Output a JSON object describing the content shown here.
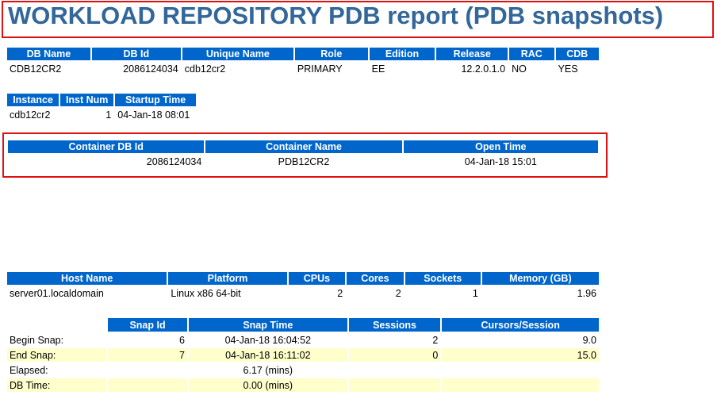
{
  "title": "WORKLOAD REPOSITORY PDB report (PDB snapshots)",
  "db_table": {
    "headers": [
      "DB Name",
      "DB Id",
      "Unique Name",
      "Role",
      "Edition",
      "Release",
      "RAC",
      "CDB"
    ],
    "row": [
      "CDB12CR2",
      "2086124034",
      "cdb12cr2",
      "PRIMARY",
      "EE",
      "12.2.0.1.0",
      "NO",
      "YES"
    ]
  },
  "instance_table": {
    "headers": [
      "Instance",
      "Inst Num",
      "Startup Time"
    ],
    "row": [
      "cdb12cr2",
      "1",
      "04-Jan-18 08:01"
    ]
  },
  "container_table": {
    "headers": [
      "Container DB Id",
      "Container Name",
      "Open Time"
    ],
    "row": [
      "2086124034",
      "PDB12CR2",
      "04-Jan-18 15:01"
    ]
  },
  "host_table": {
    "headers": [
      "Host Name",
      "Platform",
      "CPUs",
      "Cores",
      "Sockets",
      "Memory (GB)"
    ],
    "row": [
      "server01.localdomain",
      "Linux x86 64-bit",
      "2",
      "2",
      "1",
      "1.96"
    ]
  },
  "snap_table": {
    "headers": [
      "",
      "Snap Id",
      "Snap Time",
      "Sessions",
      "Cursors/Session"
    ],
    "rows": [
      [
        "Begin Snap:",
        "6",
        "04-Jan-18 16:04:52",
        "2",
        "9.0"
      ],
      [
        "End Snap:",
        "7",
        "04-Jan-18 16:11:02",
        "0",
        "15.0"
      ],
      [
        "Elapsed:",
        "",
        "6.17 (mins)",
        "",
        ""
      ],
      [
        "DB Time:",
        "",
        "0.00 (mins)",
        "",
        ""
      ]
    ]
  },
  "highlight_color": "#dd1111",
  "header_color": "#0066cc",
  "alt_row_color": "#ffffcc"
}
